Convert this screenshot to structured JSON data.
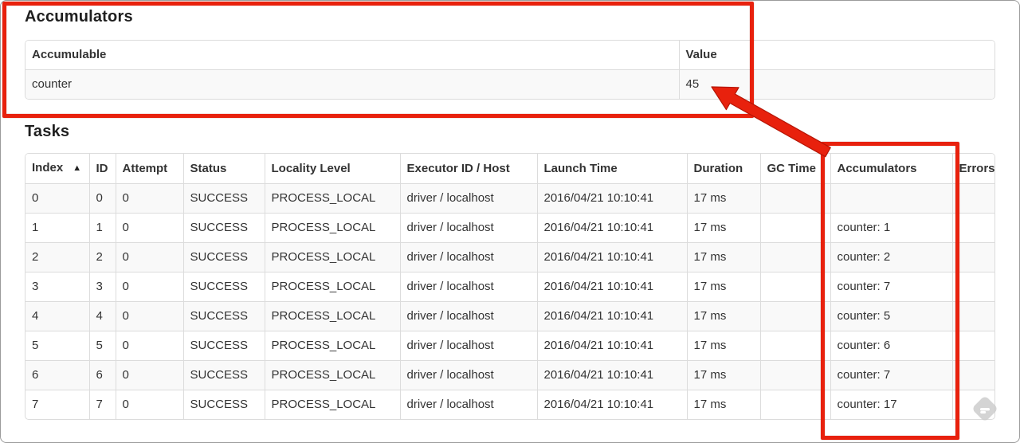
{
  "accumulators_section": {
    "title": "Accumulators"
  },
  "tasks_section": {
    "title": "Tasks"
  },
  "accumulators_table": {
    "headers": [
      {
        "label": "Accumulable"
      },
      {
        "label": "Value"
      }
    ],
    "rows": [
      [
        "counter",
        "45"
      ]
    ]
  },
  "tasks_table": {
    "headers": [
      {
        "label": "Index",
        "sort_icon": "▲"
      },
      {
        "label": "ID"
      },
      {
        "label": "Attempt"
      },
      {
        "label": "Status"
      },
      {
        "label": "Locality Level"
      },
      {
        "label": "Executor ID / Host"
      },
      {
        "label": "Launch Time"
      },
      {
        "label": "Duration"
      },
      {
        "label": "GC Time"
      },
      {
        "label": "Accumulators"
      },
      {
        "label": "Errors"
      }
    ],
    "rows": [
      [
        "0",
        "0",
        "0",
        "SUCCESS",
        "PROCESS_LOCAL",
        "driver / localhost",
        "2016/04/21 10:10:41",
        "17 ms",
        "",
        "",
        ""
      ],
      [
        "1",
        "1",
        "0",
        "SUCCESS",
        "PROCESS_LOCAL",
        "driver / localhost",
        "2016/04/21 10:10:41",
        "17 ms",
        "",
        "counter: 1",
        ""
      ],
      [
        "2",
        "2",
        "0",
        "SUCCESS",
        "PROCESS_LOCAL",
        "driver / localhost",
        "2016/04/21 10:10:41",
        "17 ms",
        "",
        "counter: 2",
        ""
      ],
      [
        "3",
        "3",
        "0",
        "SUCCESS",
        "PROCESS_LOCAL",
        "driver / localhost",
        "2016/04/21 10:10:41",
        "17 ms",
        "",
        "counter: 7",
        ""
      ],
      [
        "4",
        "4",
        "0",
        "SUCCESS",
        "PROCESS_LOCAL",
        "driver / localhost",
        "2016/04/21 10:10:41",
        "17 ms",
        "",
        "counter: 5",
        ""
      ],
      [
        "5",
        "5",
        "0",
        "SUCCESS",
        "PROCESS_LOCAL",
        "driver / localhost",
        "2016/04/21 10:10:41",
        "17 ms",
        "",
        "counter: 6",
        ""
      ],
      [
        "6",
        "6",
        "0",
        "SUCCESS",
        "PROCESS_LOCAL",
        "driver / localhost",
        "2016/04/21 10:10:41",
        "17 ms",
        "",
        "counter: 7",
        ""
      ],
      [
        "7",
        "7",
        "0",
        "SUCCESS",
        "PROCESS_LOCAL",
        "driver / localhost",
        "2016/04/21 10:10:41",
        "17 ms",
        "",
        "counter: 17",
        ""
      ]
    ]
  },
  "annotations": {
    "highlight_color": "#e8210d",
    "boxes": [
      "accumulators-section-highlight",
      "accumulators-column-highlight"
    ],
    "arrow": "points-from-accumulators-column-to-total-value-45"
  },
  "watermark": {
    "icon_color": "#cdcdcd"
  }
}
